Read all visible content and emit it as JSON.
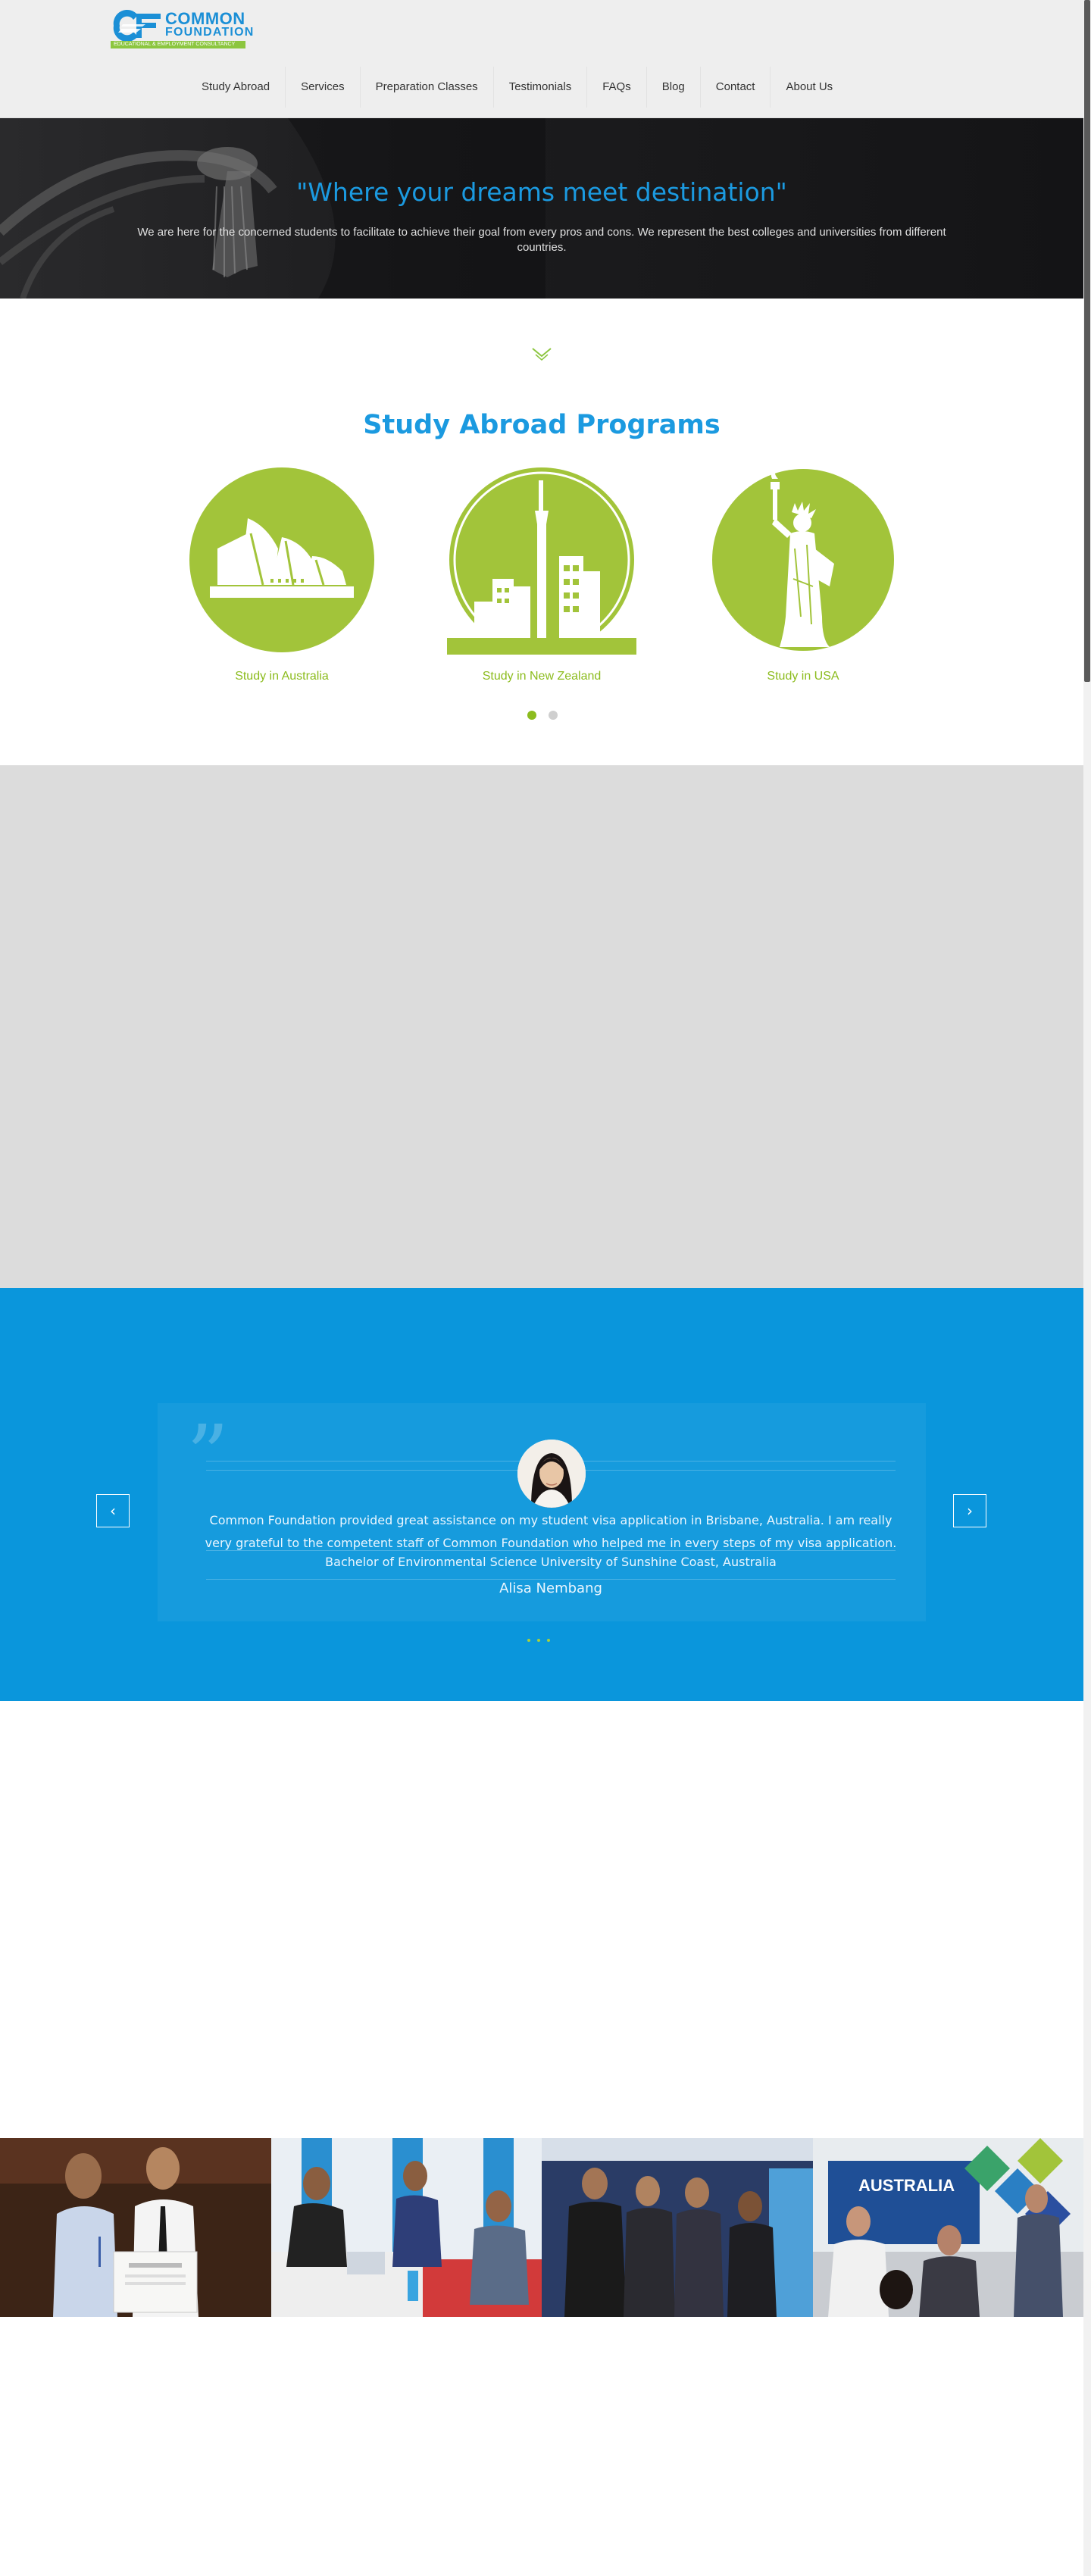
{
  "brand": {
    "name_line1": "COMMON",
    "name_line2": "FOUNDATION",
    "tagline": "EDUCATIONAL & EMPLOYMENT CONSULTANCY",
    "colors": {
      "blue": "#1b9ae0",
      "green": "#8cc63f",
      "testimonial_bg": "#0a96dc"
    }
  },
  "nav": {
    "items": [
      {
        "label": "Study Abroad"
      },
      {
        "label": "Services"
      },
      {
        "label": "Preparation Classes"
      },
      {
        "label": "Testimonials"
      },
      {
        "label": "FAQs"
      },
      {
        "label": "Blog"
      },
      {
        "label": "Contact"
      },
      {
        "label": "About Us"
      }
    ]
  },
  "hero": {
    "title": "\"Where your dreams meet destination\"",
    "subtitle": "We are here for the concerned students to facilitate to achieve their goal from every pros and cons. We represent the best colleges and universities from different countries."
  },
  "programs": {
    "title": "Study Abroad Programs",
    "items": [
      {
        "label": "Study in Australia",
        "icon": "opera-house-icon"
      },
      {
        "label": "Study in New Zealand",
        "icon": "sky-tower-icon"
      },
      {
        "label": "Study in USA",
        "icon": "statue-of-liberty-icon"
      }
    ],
    "carousel": {
      "pages": 2,
      "active_page": 1
    }
  },
  "testimonial": {
    "text": "Common Foundation provided great assistance on my student visa application in Brisbane, Australia. I am really very grateful to the competent staff of Common Foundation who helped me in every steps of my visa application.",
    "course": "Bachelor of Environmental Science University of Sunshine Coast, Australia",
    "name": "Alisa Nembang",
    "prev_icon": "chevron-left-icon",
    "next_icon": "chevron-right-icon",
    "slides": 3
  },
  "gallery": {
    "photos": [
      {
        "alt": "certificate handover photo"
      },
      {
        "alt": "counselling session photo"
      },
      {
        "alt": "group photo"
      },
      {
        "alt": "education fair booth photo"
      }
    ],
    "fair_banner_text": "AUSTRALIA"
  }
}
